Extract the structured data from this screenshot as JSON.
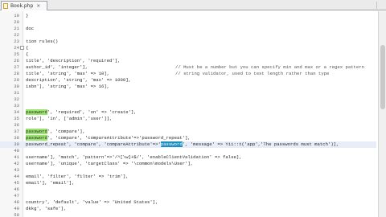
{
  "tab": {
    "label": "Book.php",
    "close": "×",
    "icon": "php-file-icon"
  },
  "lines": [
    {
      "num": "19",
      "code": "}"
    },
    {
      "num": "20",
      "code": ""
    },
    {
      "num": "21",
      "code": "doc"
    },
    {
      "num": "22",
      "code": ""
    },
    {
      "num": "23",
      "code": "tion rules()"
    },
    {
      "num": "24",
      "code": "{",
      "fold": true
    },
    {
      "num": "25",
      "code": "{"
    },
    {
      "num": "26",
      "code": "title', 'description', 'required'],"
    },
    {
      "num": "27",
      "code": "author_id', 'integer'],",
      "comment": "// Must be a number but you can specify min and max or a regex pattern"
    },
    {
      "num": "28",
      "code": "title', 'string', 'max' => 10],",
      "comment": "// string validator, used to test length rather than type"
    },
    {
      "num": "29",
      "code": "description', 'string', 'max' => 1000],"
    },
    {
      "num": "30",
      "code": "isbn'], 'string', 'max' => 16],"
    },
    {
      "num": "31",
      "code": ""
    },
    {
      "num": "32",
      "code": ""
    },
    {
      "num": "33",
      "code": ""
    },
    {
      "num": "34",
      "code": "password', 'required', 'on' => 'create'],",
      "hl": "password"
    },
    {
      "num": "35",
      "code": "role'], 'in', ['admin','user']],"
    },
    {
      "num": "36",
      "code": ""
    },
    {
      "num": "37",
      "code": "password', 'compare'],",
      "hl": "password"
    },
    {
      "num": "38",
      "code": "password', 'compare', 'compareAttribute'=>'password_repeat'],",
      "hl": "password"
    },
    {
      "num": "39",
      "code": "password_repeat', 'compare', 'compareAttribute'=>'password', 'message' => Yii::t('app','The passwords must match')],",
      "sel": "password",
      "current": true
    },
    {
      "num": "40",
      "code": ""
    },
    {
      "num": "41",
      "code": "username'], 'match', 'pattern'=>'/^[\\w]+$/', 'enableClientValidation' => false],"
    },
    {
      "num": "42",
      "code": "username'], 'unique', 'targetClass' => '\\common\\models\\User'],"
    },
    {
      "num": "43",
      "code": ""
    },
    {
      "num": "44",
      "code": "email', 'filter', 'filter' => 'trim'],"
    },
    {
      "num": "45",
      "code": "email'], 'email'],"
    },
    {
      "num": "46",
      "code": ""
    },
    {
      "num": "47",
      "code": ""
    },
    {
      "num": "48",
      "code": "country', 'default', 'value' => 'United States'],"
    },
    {
      "num": "49",
      "code": "dkkg', 'safe'],"
    },
    {
      "num": "50",
      "code": ""
    }
  ]
}
